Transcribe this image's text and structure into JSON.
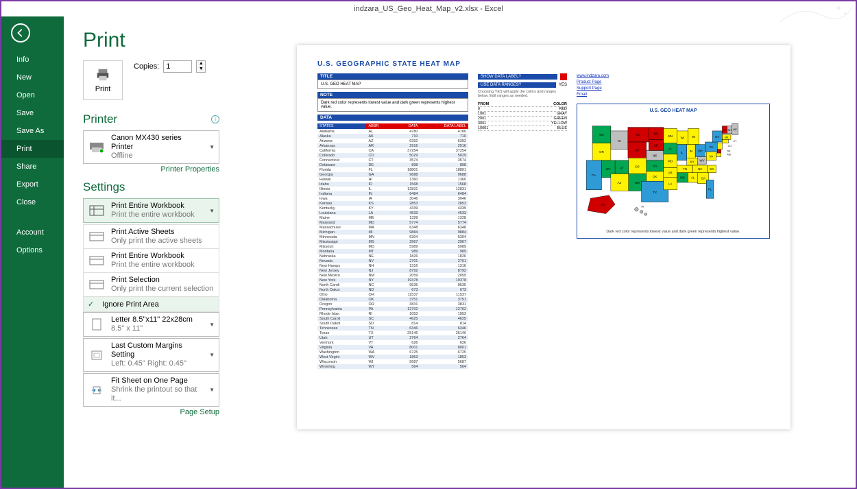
{
  "window_title": "indzara_US_Geo_Heat_Map_v2.xlsx - Excel",
  "sidebar": {
    "items": [
      "Info",
      "New",
      "Open",
      "Save",
      "Save As",
      "Print",
      "Share",
      "Export",
      "Close"
    ],
    "bottom": [
      "Account",
      "Options"
    ],
    "active": "Print"
  },
  "print_panel": {
    "heading": "Print",
    "print_btn": "Print",
    "copies_label": "Copies:",
    "copies_value": "1",
    "printer_heading": "Printer",
    "printer_name": "Canon MX430 series Printer",
    "printer_status": "Offline",
    "printer_props": "Printer Properties",
    "settings_heading": "Settings",
    "scope_selected": {
      "title": "Print Entire Workbook",
      "sub": "Print the entire workbook"
    },
    "scope_options": [
      {
        "title": "Print Active Sheets",
        "sub": "Only print the active sheets"
      },
      {
        "title": "Print Entire Workbook",
        "sub": "Print the entire workbook"
      },
      {
        "title": "Print Selection",
        "sub": "Only print the current selection"
      }
    ],
    "ignore_print_area": "Ignore Print Area",
    "paper": {
      "title": "Letter 8.5\"x11\" 22x28cm",
      "sub": "8.5\" x 11\""
    },
    "margins": {
      "title": "Last Custom Margins Setting",
      "sub": "Left: 0.45\"   Right: 0.45\""
    },
    "scaling": {
      "title": "Fit Sheet on One Page",
      "sub": "Shrink the printout so that it..."
    },
    "page_setup": "Page Setup"
  },
  "preview": {
    "title": "U.S.  GEOGRAPHIC  STATE  HEAT  MAP",
    "title_bar": "TITLE",
    "title_val": "U.S. GEO HEAT MAP",
    "note_bar": "NOTE",
    "note_val": "Dark red color represents lowest value and dark green represents highest value.",
    "show_data_label": "SHOW DATA LABEL?",
    "use_data_ranges": "USE DATA RANGES?",
    "yes": "YES",
    "ranges_note": "Choosing YES will apply the colors and ranges below. Edit ranges as needed.",
    "from": "FROM",
    "color": "COLOR",
    "ranges": [
      {
        "from": "0",
        "color": "RED"
      },
      {
        "from": "1001",
        "color": "GRAY"
      },
      {
        "from": "2001",
        "color": "GREEN"
      },
      {
        "from": "3001",
        "color": "YELLOW"
      },
      {
        "from": "10001",
        "color": "BLUE"
      }
    ],
    "links": [
      "www.indzara.com",
      "Product Page",
      "Support Page",
      "Email"
    ],
    "map_title": "U.S. GEO HEAT MAP",
    "map_caption": "Dark red color represents lowest value and dark green represents highest value.",
    "data_bar": "DATA",
    "headers": [
      "STATES",
      "ABBR",
      "DATA",
      "DATA LABEL"
    ],
    "rows": [
      [
        "Alabama",
        "AL",
        "4780",
        "4780"
      ],
      [
        "Alaska",
        "AK",
        "710",
        "710"
      ],
      [
        "Arizona",
        "AZ",
        "6392",
        "6392"
      ],
      [
        "Arkansas",
        "AR",
        "2916",
        "2916"
      ],
      [
        "California",
        "CA",
        "37254",
        "37254"
      ],
      [
        "Colorado",
        "CO",
        "5029",
        "5029"
      ],
      [
        "Connecticut",
        "CT",
        "3574",
        "3574"
      ],
      [
        "Delaware",
        "DE",
        "898",
        "898"
      ],
      [
        "Florida",
        "FL",
        "18801",
        "18801"
      ],
      [
        "Georgia",
        "GA",
        "9688",
        "9688"
      ],
      [
        "Hawaii",
        "HI",
        "1360",
        "1360"
      ],
      [
        "Idaho",
        "ID",
        "1568",
        "1568"
      ],
      [
        "Illinois",
        "IL",
        "12831",
        "12831"
      ],
      [
        "Indiana",
        "IN",
        "6484",
        "6484"
      ],
      [
        "Iowa",
        "IA",
        "3046",
        "3046"
      ],
      [
        "Kansas",
        "KS",
        "2853",
        "2853"
      ],
      [
        "Kentucky",
        "KY",
        "4339",
        "4339"
      ],
      [
        "Louisiana",
        "LA",
        "4533",
        "4533"
      ],
      [
        "Maine",
        "ME",
        "1328",
        "1328"
      ],
      [
        "Maryland",
        "MD",
        "5774",
        "5774"
      ],
      [
        "Massachuse",
        "MA",
        "6348",
        "6348"
      ],
      [
        "Michigan",
        "MI",
        "9884",
        "9884"
      ],
      [
        "Minnesota",
        "MN",
        "5304",
        "5304"
      ],
      [
        "Mississippi",
        "MS",
        "2967",
        "2967"
      ],
      [
        "Missouri",
        "MO",
        "5989",
        "5989"
      ],
      [
        "Montana",
        "MT",
        "989",
        "989"
      ],
      [
        "Nebraska",
        "NE",
        "1826",
        "1826"
      ],
      [
        "Nevada",
        "NV",
        "2701",
        "2701"
      ],
      [
        "New Hamps",
        "NH",
        "1316",
        "1316"
      ],
      [
        "New Jersey",
        "NJ",
        "8792",
        "8792"
      ],
      [
        "New Mexico",
        "NM",
        "2059",
        "2059"
      ],
      [
        "New York",
        "NY",
        "19378",
        "19378"
      ],
      [
        "North Caroli",
        "NC",
        "9535",
        "9535"
      ],
      [
        "North Dakot",
        "ND",
        "673",
        "673"
      ],
      [
        "Ohio",
        "OH",
        "11537",
        "11537"
      ],
      [
        "Oklahoma",
        "OK",
        "3751",
        "3751"
      ],
      [
        "Oregon",
        "OR",
        "3831",
        "3831"
      ],
      [
        "Pennsylvania",
        "PA",
        "12702",
        "12702"
      ],
      [
        "Rhode Islan",
        "RI",
        "1053",
        "1053"
      ],
      [
        "South Caroli",
        "SC",
        "4625",
        "4625"
      ],
      [
        "South Dakot",
        "SD",
        "814",
        "814"
      ],
      [
        "Tennessee",
        "TN",
        "6346",
        "6346"
      ],
      [
        "Texas",
        "TX",
        "25146",
        "25146"
      ],
      [
        "Utah",
        "UT",
        "2764",
        "2764"
      ],
      [
        "Vermont",
        "VT",
        "626",
        "626"
      ],
      [
        "Virginia",
        "VA",
        "8001",
        "8001"
      ],
      [
        "Washington",
        "WA",
        "6725",
        "6725"
      ],
      [
        "West Virgini",
        "WV",
        "1853",
        "1853"
      ],
      [
        "Wisconsin",
        "WI",
        "5687",
        "5687"
      ],
      [
        "Wyoming",
        "WY",
        "564",
        "564"
      ]
    ]
  },
  "chart_data": {
    "type": "heatmap",
    "title": "U.S. GEO HEAT MAP",
    "geography": "US_STATES",
    "color_ranges": [
      {
        "from": 0,
        "to": 1000,
        "color": "#d00000",
        "label": "RED"
      },
      {
        "from": 1001,
        "to": 2000,
        "color": "#bfbfbf",
        "label": "GRAY"
      },
      {
        "from": 2001,
        "to": 3000,
        "color": "#00a651",
        "label": "GREEN"
      },
      {
        "from": 3001,
        "to": 10000,
        "color": "#fff200",
        "label": "YELLOW"
      },
      {
        "from": 10001,
        "to": 999999,
        "color": "#2e9bd6",
        "label": "BLUE"
      }
    ],
    "states": [
      {
        "abbr": "AL",
        "value": 4780
      },
      {
        "abbr": "AK",
        "value": 710
      },
      {
        "abbr": "AZ",
        "value": 6392
      },
      {
        "abbr": "AR",
        "value": 2916
      },
      {
        "abbr": "CA",
        "value": 37254
      },
      {
        "abbr": "CO",
        "value": 5029
      },
      {
        "abbr": "CT",
        "value": 3574
      },
      {
        "abbr": "DE",
        "value": 898
      },
      {
        "abbr": "FL",
        "value": 18801
      },
      {
        "abbr": "GA",
        "value": 9688
      },
      {
        "abbr": "HI",
        "value": 1360
      },
      {
        "abbr": "ID",
        "value": 1568
      },
      {
        "abbr": "IL",
        "value": 12831
      },
      {
        "abbr": "IN",
        "value": 6484
      },
      {
        "abbr": "IA",
        "value": 3046
      },
      {
        "abbr": "KS",
        "value": 2853
      },
      {
        "abbr": "KY",
        "value": 4339
      },
      {
        "abbr": "LA",
        "value": 4533
      },
      {
        "abbr": "ME",
        "value": 1328
      },
      {
        "abbr": "MD",
        "value": 5774
      },
      {
        "abbr": "MA",
        "value": 6348
      },
      {
        "abbr": "MI",
        "value": 9884
      },
      {
        "abbr": "MN",
        "value": 5304
      },
      {
        "abbr": "MS",
        "value": 2967
      },
      {
        "abbr": "MO",
        "value": 5989
      },
      {
        "abbr": "MT",
        "value": 989
      },
      {
        "abbr": "NE",
        "value": 1826
      },
      {
        "abbr": "NV",
        "value": 2701
      },
      {
        "abbr": "NH",
        "value": 1316
      },
      {
        "abbr": "NJ",
        "value": 8792
      },
      {
        "abbr": "NM",
        "value": 2059
      },
      {
        "abbr": "NY",
        "value": 19378
      },
      {
        "abbr": "NC",
        "value": 9535
      },
      {
        "abbr": "ND",
        "value": 673
      },
      {
        "abbr": "OH",
        "value": 11537
      },
      {
        "abbr": "OK",
        "value": 3751
      },
      {
        "abbr": "OR",
        "value": 3831
      },
      {
        "abbr": "PA",
        "value": 12702
      },
      {
        "abbr": "RI",
        "value": 1053
      },
      {
        "abbr": "SC",
        "value": 4625
      },
      {
        "abbr": "SD",
        "value": 814
      },
      {
        "abbr": "TN",
        "value": 6346
      },
      {
        "abbr": "TX",
        "value": 25146
      },
      {
        "abbr": "UT",
        "value": 2764
      },
      {
        "abbr": "VT",
        "value": 626
      },
      {
        "abbr": "VA",
        "value": 8001
      },
      {
        "abbr": "WA",
        "value": 6725
      },
      {
        "abbr": "WV",
        "value": 1853
      },
      {
        "abbr": "WI",
        "value": 5687
      },
      {
        "abbr": "WY",
        "value": 564
      }
    ]
  }
}
